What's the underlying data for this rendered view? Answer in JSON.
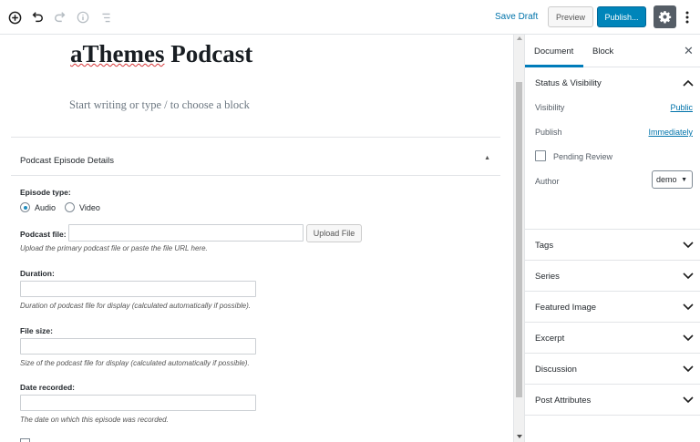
{
  "toolbar": {
    "save_draft": "Save Draft",
    "preview": "Preview",
    "publish": "Publish..."
  },
  "editor": {
    "title_word1": "aThemes",
    "title_word2": " Podcast",
    "placeholder": "Start writing or type / to choose a block"
  },
  "metabox": {
    "title": "Podcast Episode Details",
    "toggle_icon": "▲",
    "episode_type_label": "Episode type:",
    "episode_type_options": [
      "Audio",
      "Video"
    ],
    "episode_type_selected": "Audio",
    "podcast_file_label": "Podcast file:",
    "upload_button": "Upload File",
    "podcast_file_desc": "Upload the primary podcast file or paste the file URL here.",
    "duration_label": "Duration:",
    "duration_desc": "Duration of podcast file for display (calculated automatically if possible).",
    "file_size_label": "File size:",
    "file_size_desc": "Size of the podcast file for display (calculated automatically if possible).",
    "date_recorded_label": "Date recorded:",
    "date_recorded_desc": "The date on which this episode was recorded."
  },
  "sidebar": {
    "tabs": [
      "Document",
      "Block"
    ],
    "active_tab": "Document",
    "close_icon": "close-icon",
    "status_panel": {
      "title": "Status & Visibility",
      "visibility_label": "Visibility",
      "visibility_value": "Public",
      "publish_label": "Publish",
      "publish_value": "Immediately",
      "pending_review_label": "Pending Review",
      "author_label": "Author",
      "author_value": "demo"
    },
    "panels": [
      "Tags",
      "Series",
      "Featured Image",
      "Excerpt",
      "Discussion",
      "Post Attributes"
    ]
  },
  "colors": {
    "accent": "#0085ba",
    "link": "#0073aa",
    "settings_bg": "#555d66"
  }
}
